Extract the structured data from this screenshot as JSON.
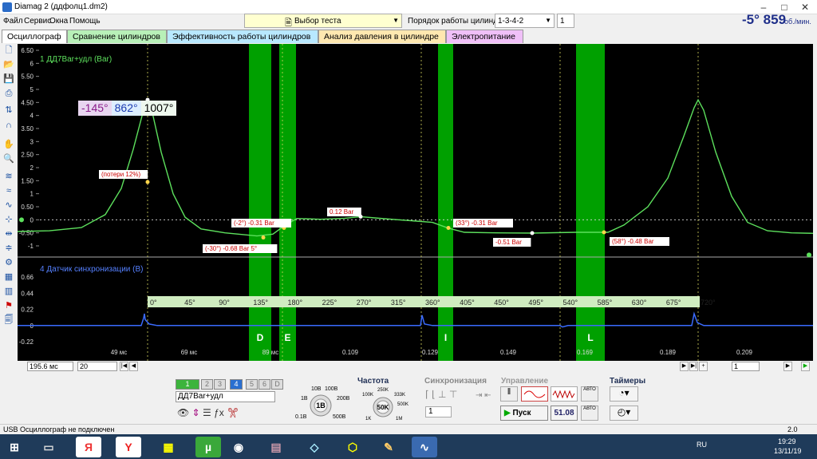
{
  "window": {
    "title": "Diamag 2 (ддфолц1.dm2)"
  },
  "menu": [
    "Файл",
    "Сервис",
    "Окна",
    "Помощь"
  ],
  "test_select": {
    "label": "Выбор теста"
  },
  "cylinder_order": {
    "label": "Порядок работы цилиндров",
    "value": "1-3-4-2",
    "cylinder": "1"
  },
  "readout": {
    "angle": "-5°",
    "rpm": "859",
    "rpm_unit": "об./мин."
  },
  "tabs": [
    {
      "label": "Осциллограф",
      "color": "#ffffff"
    },
    {
      "label": "Сравнение цилиндров",
      "color": "#b8f0b8"
    },
    {
      "label": "Эффективность работы цилиндров",
      "color": "#b8e8ff"
    },
    {
      "label": "Анализ давления в цилиндре",
      "color": "#ffe8b0"
    },
    {
      "label": "Электропитание",
      "color": "#f0c0f8"
    }
  ],
  "scope": {
    "channel1_title": "1 ДД7Bar+удл (Bar)",
    "channel4_title": "4 Датчик синхронизации (В)",
    "y1_ticks": [
      "6.50",
      "6",
      "5.50",
      "5",
      "4.50",
      "4",
      "3.50",
      "3",
      "2.50",
      "2",
      "1.50",
      "1",
      "0.50",
      "0",
      "-0.50",
      "-1"
    ],
    "y4_ticks": [
      "0.66",
      "0.44",
      "0.22",
      "0",
      "-0.22"
    ],
    "cursor": {
      "a": "-145°",
      "b": "862°",
      "delta": "1007°"
    },
    "phases": [
      "D",
      "E",
      "I",
      "L"
    ],
    "degree_ticks": [
      "0°",
      "45°",
      "90°",
      "135°",
      "180°",
      "225°",
      "270°",
      "315°",
      "360°",
      "405°",
      "450°",
      "495°",
      "540°",
      "585°",
      "630°",
      "675°",
      "720°"
    ],
    "time_ticks": [
      "49 мс",
      "69 мс",
      "89 мс",
      "0.109",
      "0.129",
      "0.149",
      "0.169",
      "0.189",
      "0.209"
    ],
    "annotations": {
      "losses": "(потери 12%)",
      "a1": "(-2°) -0.31 Bar",
      "a2": "(-30°) -0.68 Bar 5°",
      "a3": "0.12 Bar",
      "a4": "(33°) -0.31 Bar",
      "a5": "-0.51 Bar",
      "a6": "(58°) -0.48 Bar"
    },
    "colors": {
      "pressure": "#5de05d",
      "sync": "#3a6bff",
      "phase": "#00a000"
    }
  },
  "scope_nav": {
    "timebase": "195.6 мс",
    "zoom": "20",
    "page": "1"
  },
  "controls": {
    "channels": [
      "1",
      "2",
      "3",
      "4",
      "5",
      "6",
      "D"
    ],
    "channel_name": "ДД7Bar+удл",
    "range_title": "",
    "range_labels": [
      "10В",
      "100В",
      "200В",
      "500В",
      "0.1В",
      "1В"
    ],
    "range_value": "1В",
    "freq_title": "Частота",
    "freq_labels": [
      "250K",
      "100K",
      "333K",
      "500K",
      "1M",
      "1K",
      "5K",
      "10K"
    ],
    "freq_value": "50K",
    "sync_title": "Синхронизация",
    "sync_value": "1",
    "mgmt_title": "Управление",
    "start_label": "Пуск",
    "fps": "51.08",
    "auto_label": "АВТО",
    "timers_title": "Таймеры"
  },
  "status": {
    "left": "USB Осциллограф не подключен",
    "right": "2.0"
  },
  "tray": {
    "lang": "RU",
    "time": "19:29",
    "date": "13/11/19"
  }
}
